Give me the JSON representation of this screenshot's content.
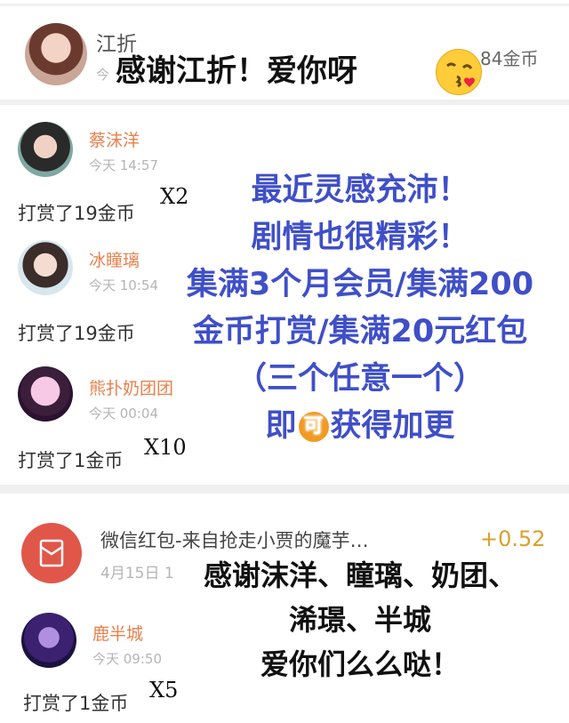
{
  "top_entry": {
    "name": "江折",
    "time_partial": "今",
    "amount": "84金币",
    "overlay": "感谢江折！爱你呀"
  },
  "entries": [
    {
      "name": "蔡沫洋",
      "time": "今天 14:57",
      "tip": "打赏了19金币",
      "multiplier": "X2"
    },
    {
      "name": "冰瞳璃",
      "time": "今天 10:54",
      "tip": "打赏了19金币",
      "multiplier": ""
    },
    {
      "name": "熊扑奶团团",
      "time": "今天 00:04",
      "tip": "打赏了1金币",
      "multiplier": "X10"
    }
  ],
  "announcement": {
    "lines": [
      "最近灵感充沛！",
      "剧情也很精彩！",
      "集满3个月会员/集满200",
      "金币打赏/集满20元红包",
      "（三个任意一个）"
    ],
    "last_line_before": "即",
    "badge": "可",
    "last_line_after": "获得加更"
  },
  "wechat_entry": {
    "title": "微信红包-来自抢走小贾的魔芋…",
    "amount": "+0.52",
    "date": "4月15日 1"
  },
  "last_entry": {
    "name": "鹿半城",
    "time": "今天 09:50",
    "tip": "打赏了1金币",
    "multiplier": "X5"
  },
  "thanks": {
    "lines": [
      "感谢沫洋、瞳璃、奶团、",
      "浠璟、半城",
      "爱你们么么哒！"
    ]
  },
  "colors": {
    "announcement_blue": "#3f4fc8",
    "name_orange": "#e8804d",
    "plus_gold": "#d9a02a",
    "red_packet": "#e0574a"
  }
}
